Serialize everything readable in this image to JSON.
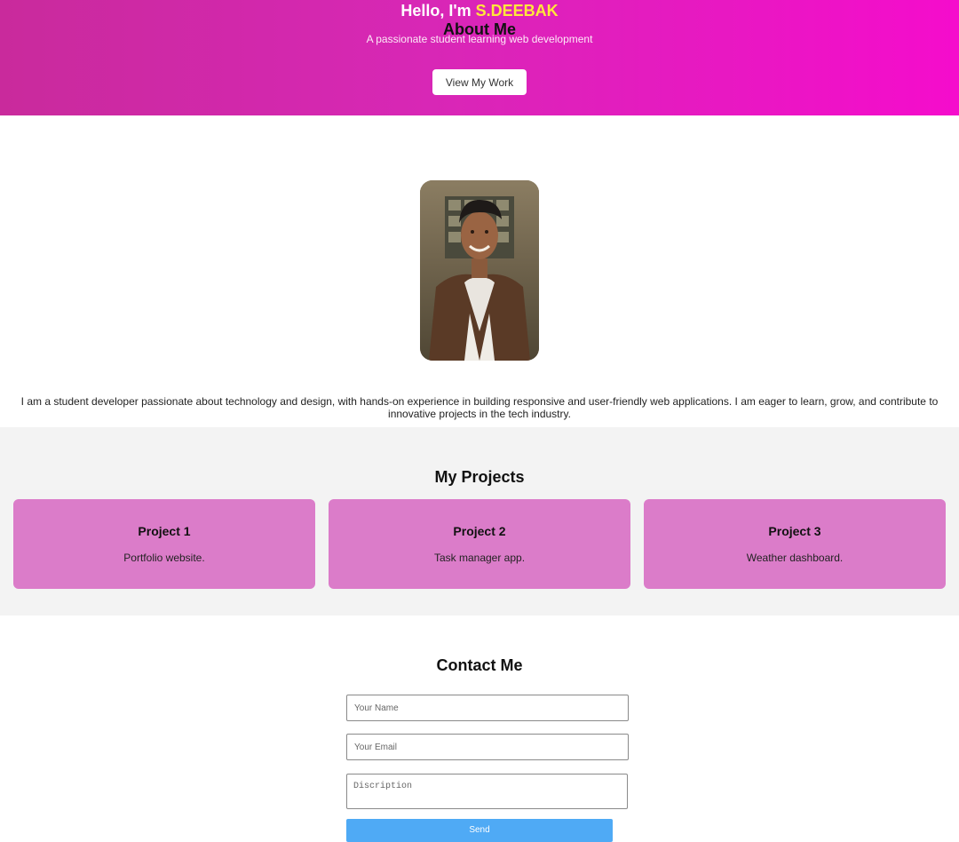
{
  "hero": {
    "greeting": "Hello, I'm",
    "name": "S.DEEBAK",
    "subtitle": "A passionate student learning web development",
    "button_label": "View My Work"
  },
  "about": {
    "title": "About Me",
    "photo_icon": "profile-photo",
    "text": "I am a student developer passionate about technology and design, with hands-on experience in building responsive and user-friendly web applications. I am eager to learn, grow, and contribute to innovative projects in the tech industry."
  },
  "projects": {
    "title": "My Projects",
    "items": [
      {
        "title": "Project 1",
        "description": "Portfolio website."
      },
      {
        "title": "Project 2",
        "description": "Task manager app."
      },
      {
        "title": "Project 3",
        "description": "Weather dashboard."
      }
    ]
  },
  "contact": {
    "title": "Contact Me",
    "name_placeholder": "Your Name",
    "email_placeholder": "Your Email",
    "description_placeholder": "Discription",
    "send_label": "Send"
  },
  "colors": {
    "hero_gradient_start": "#c92a9c",
    "hero_gradient_end": "#f50ccc",
    "name_highlight": "#ffe83a",
    "card_bg": "#db7cc9",
    "send_button": "#4faaf5"
  }
}
